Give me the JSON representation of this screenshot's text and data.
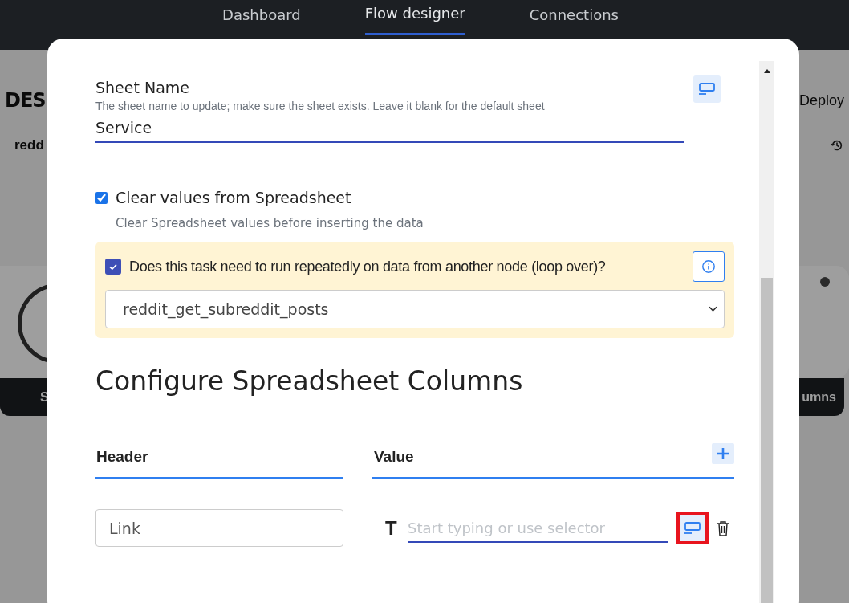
{
  "nav": {
    "tabs": [
      {
        "label": "Dashboard",
        "selected": false
      },
      {
        "label": "Flow designer",
        "selected": true
      },
      {
        "label": "Connections",
        "selected": false
      }
    ]
  },
  "backdrop": {
    "title": "DES",
    "deploy": "Deploy",
    "source": "redd",
    "left_tab": "S",
    "right_tab": "umns"
  },
  "dialog": {
    "sheet_name": {
      "label": "Sheet Name",
      "description": "The sheet name to update; make sure the sheet exists. Leave it blank for the default sheet",
      "value": "Service"
    },
    "clear_values": {
      "label": "Clear values from Spreadsheet",
      "checked": true,
      "description": "Clear Spreadsheet values before inserting the data"
    },
    "loop": {
      "label": "Does this task need to run repeatedly on data from another node (loop over)?",
      "checked": true,
      "value": "reddit_get_subreddit_posts"
    },
    "section_title": "Configure Spreadsheet Columns",
    "columns": {
      "header": "Header",
      "value": "Value"
    },
    "rows": [
      {
        "header": "Link",
        "type_glyph": "T",
        "placeholder": "Start typing or use selector"
      }
    ]
  }
}
